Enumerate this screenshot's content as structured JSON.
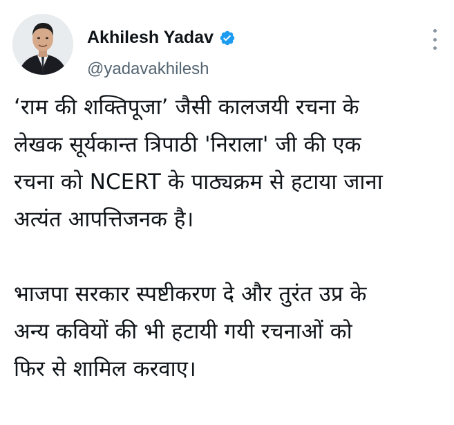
{
  "author": {
    "display_name": "Akhilesh Yadav",
    "handle": "@yadavakhilesh",
    "verified": true,
    "verified_badge_color": "#1d9bf0"
  },
  "icons": {
    "verified": "verified-badge-icon",
    "more": "more-options-icon"
  },
  "tweet": {
    "paragraphs": [
      {
        "lines": [
          "‘राम की शक्तिपूजा’ जैसी कालजयी रचना के",
          "लेखक सूर्यकान्त त्रिपाठी 'निराला' जी की एक",
          "रचना को NCERT के पाठ्यक्रम से हटाया जाना",
          "अत्यंत आपत्तिजनक है।"
        ]
      },
      {
        "lines": [
          "भाजपा सरकार स्पष्टीकरण दे और तुरंत उप्र के",
          "अन्य कवियों की भी हटायी गयी रचनाओं को",
          "फिर से शामिल करवाए।"
        ]
      }
    ]
  }
}
